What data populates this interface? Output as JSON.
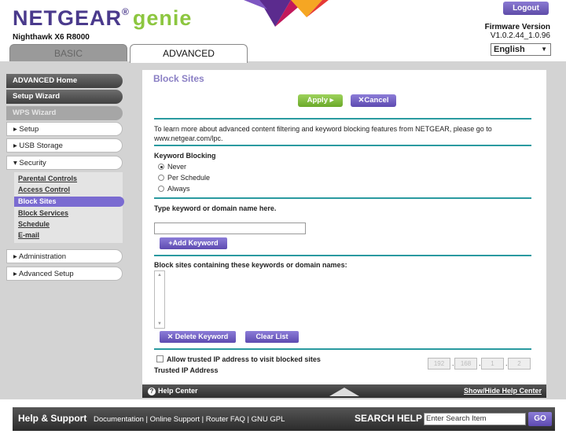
{
  "header": {
    "brand": "NETGEAR",
    "brand_reg": "®",
    "brand_genie": "genie",
    "model": "Nighthawk X6 R8000",
    "logout_label": "Logout",
    "firmware_label": "Firmware Version",
    "firmware_value": "V1.0.2.44_1.0.96",
    "language": "English",
    "tabs": {
      "basic": "BASIC",
      "advanced": "ADVANCED"
    }
  },
  "sidebar": {
    "advanced_home": "ADVANCED Home",
    "setup_wizard": "Setup Wizard",
    "wps_wizard": "WPS Wizard",
    "setup": "▸ Setup",
    "usb_storage": "▸ USB Storage",
    "security": "▾ Security",
    "security_items": [
      "Parental Controls",
      "Access Control",
      "Block Sites",
      "Block Services",
      "Schedule",
      "E-mail"
    ],
    "administration": "▸ Administration",
    "advanced_setup": "▸ Advanced Setup"
  },
  "content": {
    "title": "Block Sites",
    "apply_label": "Apply ▸",
    "cancel_label": "✕Cancel",
    "info_text": "To learn more about advanced content filtering and keyword blocking features from NETGEAR, please go to www.netgear.com/lpc.",
    "keyword_blocking_label": "Keyword Blocking",
    "radio_never": "Never",
    "radio_per_schedule": "Per Schedule",
    "radio_always": "Always",
    "keyword_prompt": "Type keyword or domain name here.",
    "add_keyword_label": "+Add Keyword",
    "block_list_label": "Block sites containing these keywords or domain names:",
    "delete_keyword_label": "✕ Delete Keyword",
    "clear_list_label": "Clear List",
    "allow_trusted_label": "Allow trusted IP address to visit blocked sites",
    "trusted_ip_label": "Trusted IP Address",
    "trusted_ip": [
      "192",
      "168",
      "1",
      "2"
    ]
  },
  "helpbar": {
    "help_center": "Help Center",
    "toggle": "Show/Hide Help Center"
  },
  "footer": {
    "help_support": "Help & Support",
    "links": "Documentation | Online Support | Router FAQ | GNU GPL",
    "search_help": "SEARCH HELP",
    "search_value": "Enter Search Item",
    "go_label": "GO"
  },
  "colors": {
    "brand_purple": "#4a3a8c",
    "genie_green": "#8cc63f",
    "accent_purple": "#7a6bd1",
    "divider_teal": "#2a9aa0",
    "apply_green": "#7ab83a"
  }
}
